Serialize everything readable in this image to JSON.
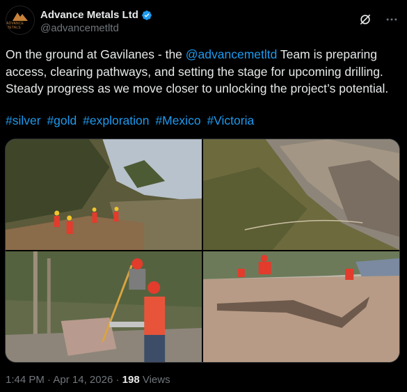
{
  "author": {
    "display_name": "Advance Metals Ltd",
    "handle": "@advancemetltd",
    "avatar_text": "ADVANCE METALS"
  },
  "tweet": {
    "text_before": "On the ground at Gavilanes - the ",
    "mention": "@advancemetltd",
    "text_after": " Team is preparing access, clearing pathways, and setting the stage for upcoming drilling. Steady progress as we move closer to unlocking the project’s potential.",
    "hashtags": [
      "#silver",
      "#gold",
      "#exploration",
      "#Mexico",
      "#Victoria"
    ]
  },
  "meta": {
    "time": "1:44 PM",
    "separator": " · ",
    "date": "Apr 14, 2026",
    "views_count": "198",
    "views_label": "Views"
  },
  "colors": {
    "link": "#1d9bf0",
    "muted": "#71767b",
    "text": "#e7e9ea",
    "bg": "#000000"
  }
}
